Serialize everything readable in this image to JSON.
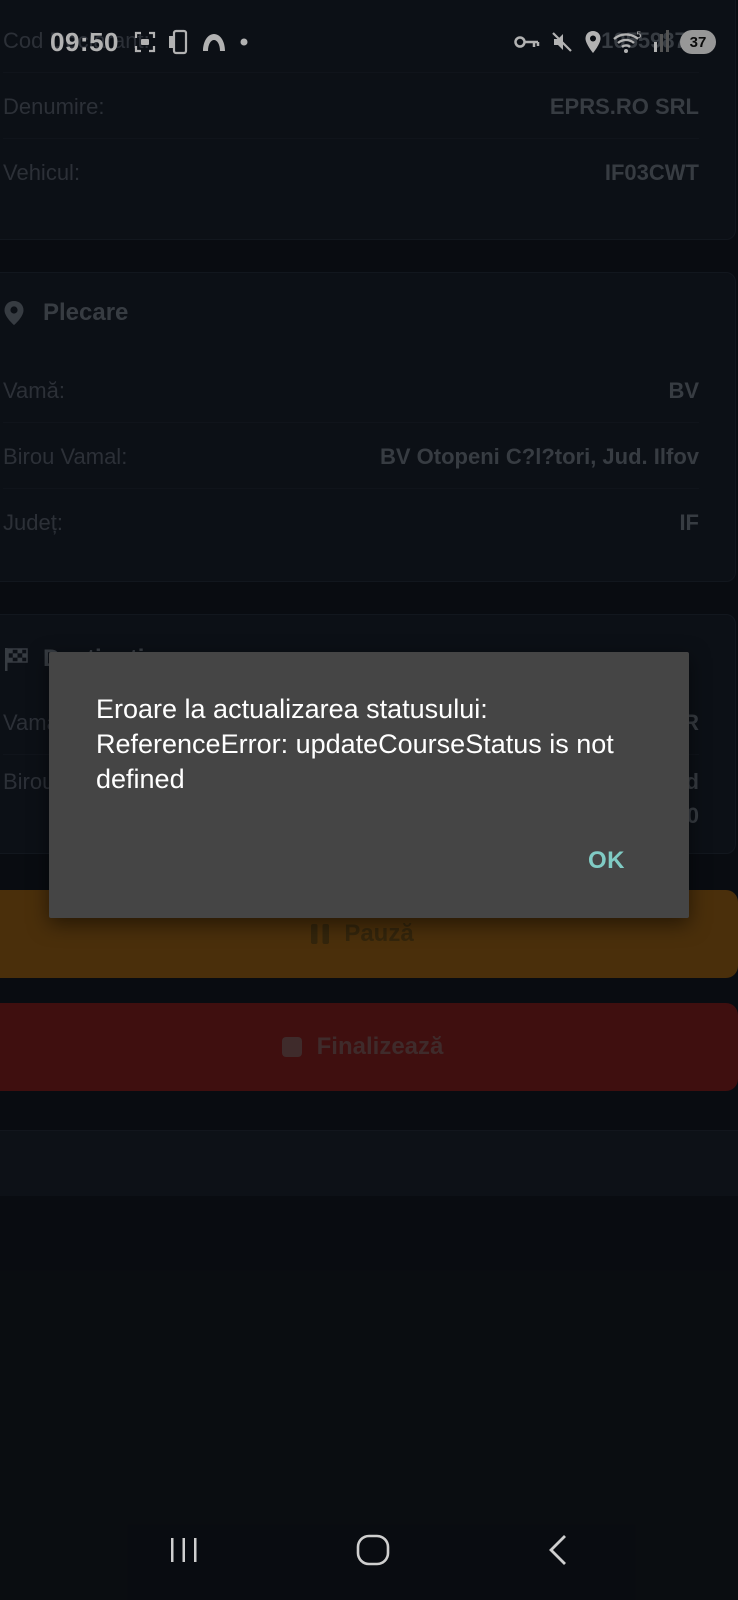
{
  "status_bar": {
    "time": "09:50",
    "battery": "37",
    "icons_left": [
      "screenshot-icon",
      "phone-cast-icon",
      "cloud-icon",
      "dot-icon"
    ],
    "icons_right": [
      "key-icon",
      "mute-icon",
      "location-icon",
      "wifi-icon",
      "signal-icon",
      "battery-icon"
    ]
  },
  "card_info": {
    "rows": [
      {
        "label": "Cod Declarant:",
        "value": "10559878"
      },
      {
        "label": "Denumire:",
        "value": "EPRS.RO SRL"
      },
      {
        "label": "Vehicul:",
        "value": "IF03CWT"
      }
    ]
  },
  "card_departure": {
    "title": "Plecare",
    "rows": [
      {
        "label": "Vamă:",
        "value": "BV"
      },
      {
        "label": "Birou Vamal:",
        "value": "BV Otopeni C?l?tori, Jud. Ilfov"
      },
      {
        "label": "Județ:",
        "value": "IF"
      }
    ]
  },
  "card_destination": {
    "title": "Destinație",
    "rows": [
      {
        "label": "Vamă:",
        "value": "DR"
      },
      {
        "label": "Birou Vamal:",
        "value_line1": "od",
        "value_line2": "00"
      }
    ]
  },
  "buttons": {
    "pause_label": "Pauză",
    "finish_label": "Finalizează"
  },
  "dialog": {
    "message": "Eroare la actualizarea statusului: ReferenceError: updateCourseStatus is not defined",
    "ok_label": "OK"
  },
  "colors": {
    "dialog_bg": "#454545",
    "ok_accent": "#80cbc4",
    "pause_btn": "#6b4410",
    "finish_btn": "#5b1616"
  }
}
